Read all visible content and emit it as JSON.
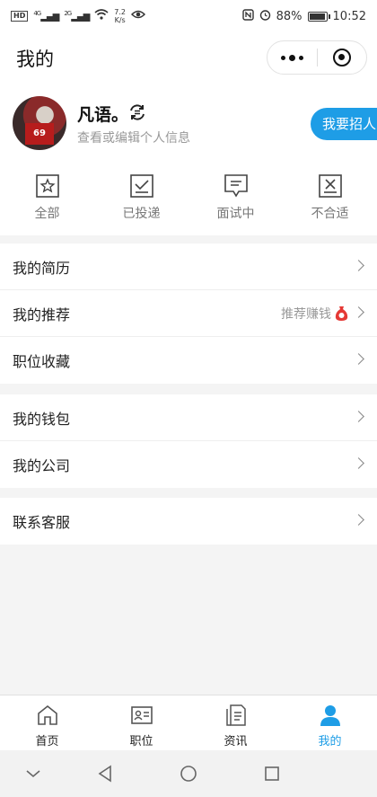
{
  "status_bar": {
    "network_badge": "HD",
    "signal1_label": "4G",
    "signal2_label": "2G",
    "speed_value": "7.2",
    "speed_unit": "K/s",
    "battery_percent": "88%",
    "battery_level": 0.88,
    "time": "10:52"
  },
  "header": {
    "title": "我的",
    "more_icon": "more-dots-icon",
    "close_icon": "target-close-icon"
  },
  "profile": {
    "name": "凡语。",
    "subtitle": "查看或编辑个人信息",
    "jersey_number": "69",
    "recruit_button": "我要招人",
    "switch_icon": "switch-role-icon"
  },
  "application_status": [
    {
      "label": "全部",
      "icon": "star-icon"
    },
    {
      "label": "已投递",
      "icon": "check-box-icon"
    },
    {
      "label": "面试中",
      "icon": "chat-bubble-icon"
    },
    {
      "label": "不合适",
      "icon": "x-box-icon"
    }
  ],
  "menu_groups": [
    {
      "items": [
        {
          "label": "我的简历"
        },
        {
          "label": "我的推荐",
          "extra": "推荐赚钱"
        },
        {
          "label": "职位收藏"
        }
      ]
    },
    {
      "items": [
        {
          "label": "我的钱包"
        },
        {
          "label": "我的公司"
        }
      ]
    },
    {
      "items": [
        {
          "label": "联系客服"
        }
      ]
    }
  ],
  "tabs": [
    {
      "label": "首页",
      "icon": "home-icon"
    },
    {
      "label": "职位",
      "icon": "id-card-icon"
    },
    {
      "label": "资讯",
      "icon": "document-icon"
    },
    {
      "label": "我的",
      "icon": "person-icon",
      "active": true
    }
  ],
  "colors": {
    "accent": "#1e9de6",
    "background": "#f4f4f4",
    "text_secondary": "#999999",
    "reward_badge": "#e53935"
  }
}
